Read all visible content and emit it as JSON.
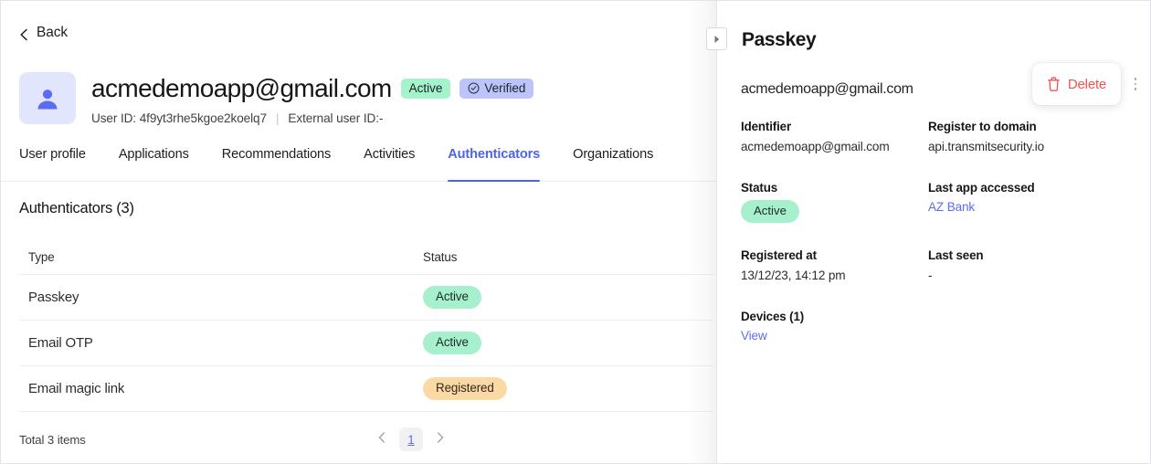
{
  "nav": {
    "back_label": "Back",
    "back_icon": "chevron-left-icon"
  },
  "user": {
    "avatar_icon": "person-avatar-icon",
    "email": "acmedemoapp@gmail.com",
    "status_badge": "Active",
    "verified_badge": "Verified",
    "verified_icon": "check-circle-icon",
    "user_id_label": "User ID: 4f9yt3rhe5kgoe2koelq7",
    "separator": "|",
    "external_user_id_label": "External user ID:-"
  },
  "tabs": [
    {
      "label": "User profile",
      "active": false
    },
    {
      "label": "Applications",
      "active": false
    },
    {
      "label": "Recommendations",
      "active": false
    },
    {
      "label": "Activities",
      "active": false
    },
    {
      "label": "Authenticators",
      "active": true
    },
    {
      "label": "Organizations",
      "active": false
    }
  ],
  "section": {
    "title": "Authenticators (3)"
  },
  "table": {
    "columns": [
      "Type",
      "Status"
    ],
    "rows": [
      {
        "type": "Passkey",
        "status": "Active",
        "status_kind": "active"
      },
      {
        "type": "Email OTP",
        "status": "Active",
        "status_kind": "active"
      },
      {
        "type": "Email magic link",
        "status": "Registered",
        "status_kind": "registered"
      }
    ]
  },
  "pagination": {
    "total_text": "Total 3 items",
    "prev_icon": "chevron-left-icon",
    "next_icon": "chevron-right-icon",
    "current_page": "1"
  },
  "panel": {
    "collapse_icon": "triangle-right-icon",
    "title": "Passkey",
    "subtitle": "acmedemoapp@gmail.com",
    "delete": {
      "label": "Delete",
      "icon": "trash-icon"
    },
    "kebab_icon": "more-vertical-icon",
    "fields": {
      "identifier_label": "Identifier",
      "identifier_value": "acmedemoapp@gmail.com",
      "register_domain_label": "Register to domain",
      "register_domain_value": "api.transmitsecurity.io",
      "status_label": "Status",
      "status_value": "Active",
      "last_app_label": "Last app accessed",
      "last_app_value": "AZ Bank",
      "registered_at_label": "Registered at",
      "registered_at_value": "13/12/23, 14:12 pm",
      "last_seen_label": "Last seen",
      "last_seen_value": "-",
      "devices_label": "Devices (1)",
      "devices_link": "View"
    }
  },
  "colors": {
    "accent": "#4c63f0",
    "link": "#5b6cf3",
    "danger": "#f4524d",
    "badge_active_bg": "#a7f0cd",
    "badge_registered_bg": "#fbd9a4",
    "badge_verified_bg": "#bdc4f7",
    "avatar_bg": "#e2e6fd"
  }
}
